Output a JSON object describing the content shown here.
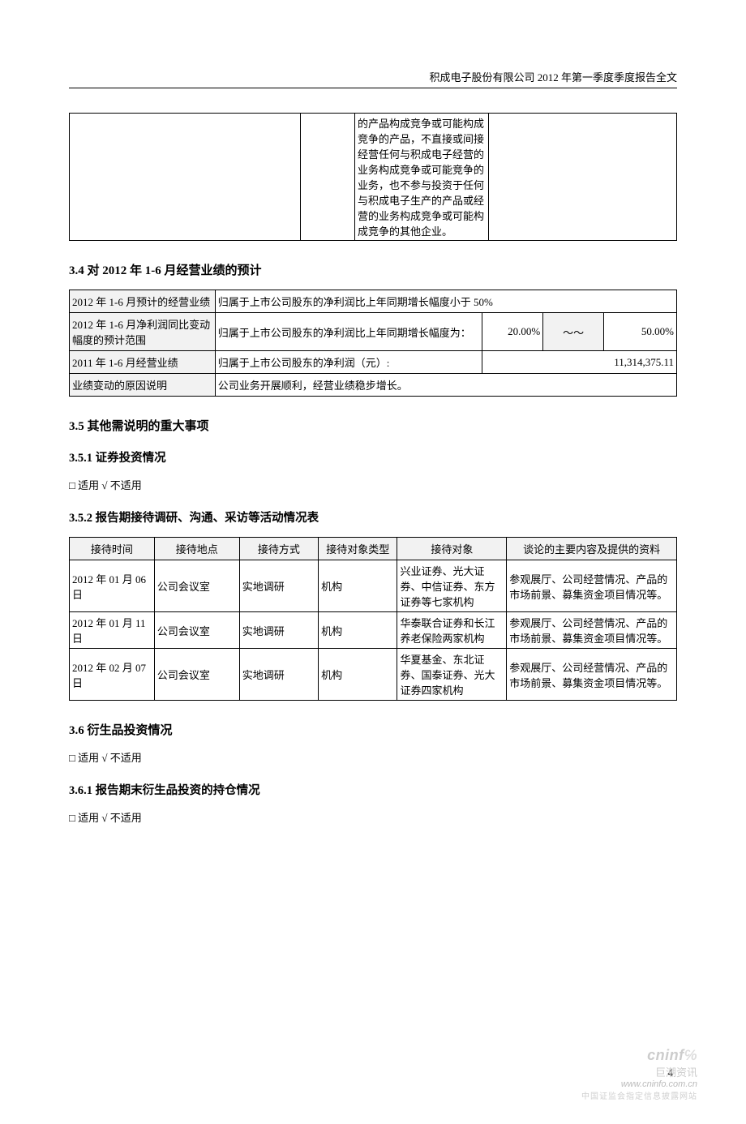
{
  "header": "积成电子股份有限公司 2012 年第一季度季度报告全文",
  "partial_cell": "的产品构成竞争或可能构成竞争的产品，不直接或间接经营任何与积成电子经营的业务构成竞争或可能竞争的业务，也不参与投资于任何与积成电子生产的产品或经营的业务构成竞争或可能构成竞争的其他企业。",
  "s34": {
    "heading": "3.4 对 2012 年 1-6 月经营业绩的预计",
    "rows": {
      "r1_label": "2012 年 1-6 月预计的经营业绩",
      "r1_value": "归属于上市公司股东的净利润比上年同期增长幅度小于 50%",
      "r2_label": "2012 年 1-6 月净利润同比变动幅度的预计范围",
      "r2_text": "归属于上市公司股东的净利润比上年同期增长幅度为：",
      "r2_low": "20.00%",
      "r2_sep": "～～",
      "r2_high": "50.00%",
      "r3_label": "2011 年 1-6 月经营业绩",
      "r3_text": "归属于上市公司股东的净利润（元）:",
      "r3_value": "11,314,375.11",
      "r4_label": "业绩变动的原因说明",
      "r4_value": "公司业务开展顺利，经营业绩稳步增长。"
    }
  },
  "s35": {
    "heading": "3.5 其他需说明的重大事项",
    "s351": {
      "heading": "3.5.1 证券投资情况",
      "applicable": "□ 适用 √ 不适用"
    },
    "s352": {
      "heading": "3.5.2 报告期接待调研、沟通、采访等活动情况表",
      "headers": [
        "接待时间",
        "接待地点",
        "接待方式",
        "接待对象类型",
        "接待对象",
        "谈论的主要内容及提供的资料"
      ],
      "rows": [
        {
          "date": "2012 年 01 月 06 日",
          "place": "公司会议室",
          "method": "实地调研",
          "type": "机构",
          "target": "兴业证券、光大证券、中信证券、东方证券等七家机构",
          "content": "参观展厅、公司经营情况、产品的市场前景、募集资金项目情况等。"
        },
        {
          "date": "2012 年 01 月 11 日",
          "place": "公司会议室",
          "method": "实地调研",
          "type": "机构",
          "target": "华泰联合证券和长江养老保险两家机构",
          "content": "参观展厅、公司经营情况、产品的市场前景、募集资金项目情况等。"
        },
        {
          "date": "2012 年 02 月 07 日",
          "place": "公司会议室",
          "method": "实地调研",
          "type": "机构",
          "target": "华夏基金、东北证券、国泰证券、光大证券四家机构",
          "content": "参观展厅、公司经营情况、产品的市场前景、募集资金项目情况等。"
        }
      ]
    }
  },
  "s36": {
    "heading": "3.6 衍生品投资情况",
    "applicable": "□ 适用 √ 不适用",
    "s361": {
      "heading": "3.6.1 报告期末衍生品投资的持仓情况",
      "applicable": "□ 适用 √ 不适用"
    }
  },
  "page_number": "4",
  "watermark": {
    "logo": "cninf",
    "cn": "巨潮资讯",
    "url": "www.cninfo.com.cn",
    "sub": "中国证监会指定信息披露网站"
  }
}
